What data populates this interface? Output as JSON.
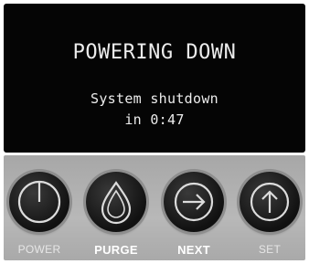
{
  "display": {
    "title": "POWERING DOWN",
    "message_line1": "System shutdown",
    "message_line2": "in 0:47"
  },
  "buttons": [
    {
      "label": "POWER",
      "icon": "power-icon"
    },
    {
      "label": "PURGE",
      "icon": "droplet-icon"
    },
    {
      "label": "NEXT",
      "icon": "arrow-right-icon"
    },
    {
      "label": "SET",
      "icon": "arrow-up-icon"
    }
  ],
  "colors": {
    "screen_background": "#050505",
    "screen_text": "#ececec",
    "panel": "#b0b0b0",
    "button": "#111111"
  }
}
